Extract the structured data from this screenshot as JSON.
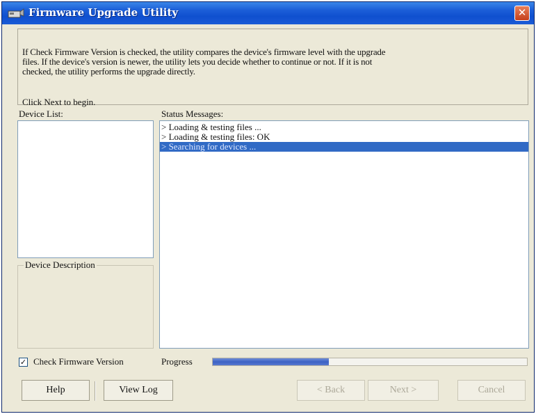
{
  "window": {
    "title": "Firmware Upgrade Utility",
    "close_glyph": "✕"
  },
  "intro": {
    "lines": [
      "If Check Firmware Version is checked, the utility compares the device's firmware level with the upgrade",
      "files. If the device's version is newer, the utility lets you decide whether to continue or not. If it is not",
      "checked, the utility performs the upgrade directly."
    ],
    "begin": "Click Next to begin."
  },
  "device_list": {
    "label": "Device List:"
  },
  "device_description": {
    "label": "Device Description"
  },
  "status": {
    "label": "Status Messages:",
    "messages": [
      "> Loading & testing files ...",
      "> Loading & testing files: OK",
      "> Searching for devices ..."
    ],
    "selected_index": 2
  },
  "options": {
    "check_firmware_label": "Check Firmware Version",
    "check_firmware_checked": true,
    "check_glyph": "✓"
  },
  "progress": {
    "label": "Progress",
    "fraction": 0.37
  },
  "buttons": {
    "help": "Help",
    "view_log": "View Log",
    "back": "< Back",
    "next": "Next >",
    "cancel": "Cancel"
  },
  "colors": {
    "titlebar": "#1c5fd8",
    "selection": "#316ac5",
    "progress": "#3c62c4"
  }
}
